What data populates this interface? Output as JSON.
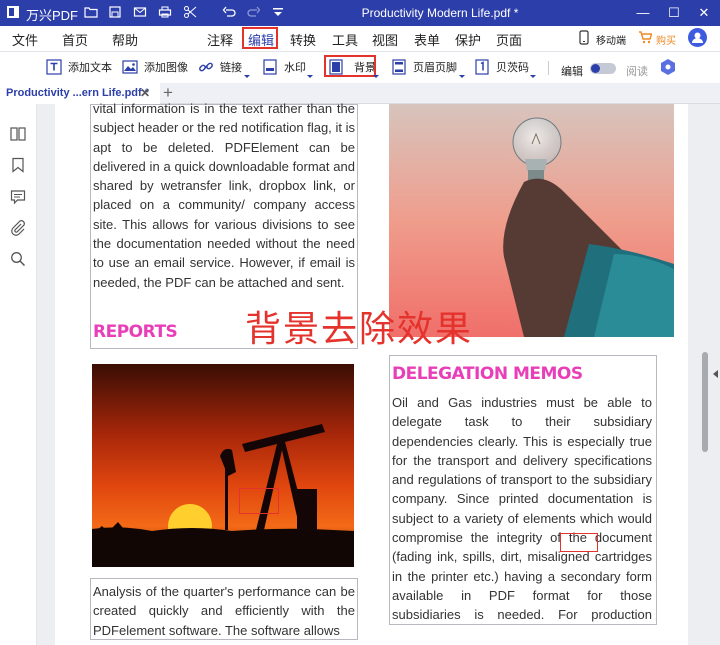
{
  "titlebar": {
    "app_name": "万兴PDF",
    "doc_title": "Productivity Modern Life.pdf *",
    "minimize": "—",
    "maximize": "☐",
    "close": "✕",
    "bg_color": "#2c3eaa"
  },
  "menubar": {
    "left_items": [
      "文件",
      "首页",
      "帮助"
    ],
    "center_items": [
      "注释",
      "编辑",
      "转换",
      "工具",
      "视图",
      "表单",
      "保护",
      "页面"
    ],
    "active_item": "编辑",
    "mobile_label": "移动端",
    "buy_label": "购买"
  },
  "toolbar": {
    "add_text": "添加文本",
    "add_image": "添加图像",
    "link": "链接",
    "watermark": "水印",
    "background": "背景",
    "header_footer": "页眉页脚",
    "page_number": "贝茨码",
    "edit_label": "编辑",
    "read_label": "阅读"
  },
  "tab": {
    "label": "Productivity ...ern Life.pdf *",
    "close": "✕",
    "add": "+"
  },
  "document": {
    "col1_text": "vital information is in the text rather than the subject header or the red notification flag, it is apt to be deleted. PDFElement can be delivered in a quick downloadable format and shared by wetransfer link, dropbox link, or placed on a community/ company access site. This allows for various divisions to see the documentation needed without the need to use an email service. However, if email is needed, the PDF can be attached and sent.",
    "reports_heading": "REPORTS",
    "overlay_caption": "背景去除效果",
    "delegation_heading": "DELEGATION MEMOS",
    "delegation_text": "Oil and Gas industries must be able to delegate task to their subsidiary dependencies clearly. This is especially true for the transport and delivery specifications and regulations of transport to the subsidiary company. Since printed documentation is subject to a variety of elements which would compromise the integrity of the document (fading ink, spills, dirt, misaligned cartridges in the printer etc.) having a secondary form available in PDF format for those subsidiaries is needed. For production purposes, having this PDF on hand",
    "analysis_text": "Analysis of the quarter's performance can be created quickly and efficiently with the PDFelement software. The software allows"
  },
  "colors": {
    "accent": "#2c3eaa",
    "heading_pink": "#e83fb8",
    "highlight_red": "#e4332c"
  }
}
